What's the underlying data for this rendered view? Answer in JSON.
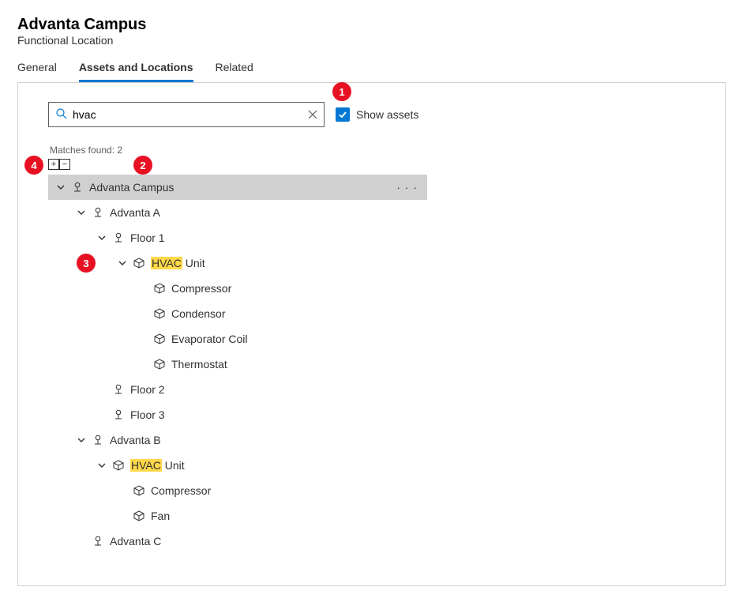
{
  "header": {
    "title": "Advanta Campus",
    "subtitle": "Functional Location"
  },
  "tabs": {
    "general": "General",
    "assets": "Assets and Locations",
    "related": "Related"
  },
  "search": {
    "value": "hvac",
    "matches_label": "Matches found: 2",
    "show_assets_label": "Show assets"
  },
  "callouts": {
    "c1": "1",
    "c2": "2",
    "c3": "3",
    "c4": "4"
  },
  "tree": {
    "root": "Advanta Campus",
    "advA": "Advanta A",
    "floor1": "Floor 1",
    "hvac_hl": "HVAC",
    "unit_rest": " Unit",
    "compressor": "Compressor",
    "condensor": "Condensor",
    "evap": "Evaporator Coil",
    "thermo": "Thermostat",
    "floor2": "Floor 2",
    "floor3": "Floor 3",
    "advB": "Advanta B",
    "fan": "Fan",
    "advC": "Advanta C"
  }
}
